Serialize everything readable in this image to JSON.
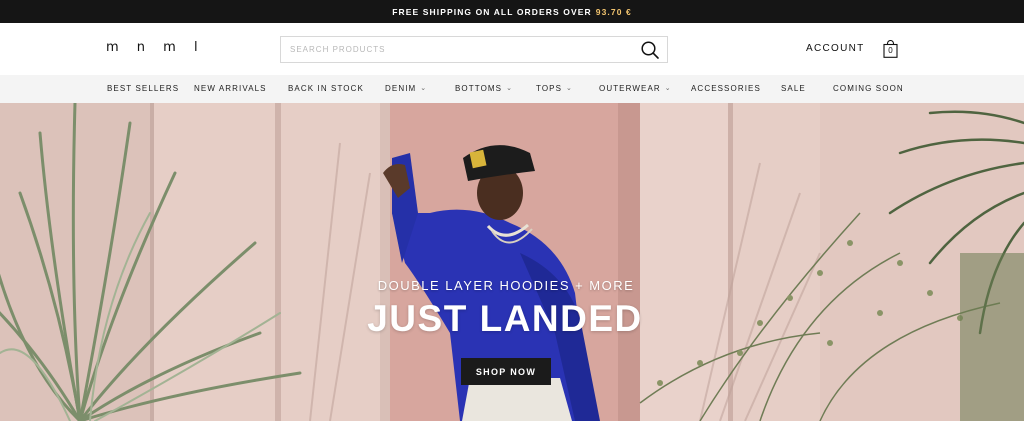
{
  "promo": {
    "text": "FREE SHIPPING ON ALL ORDERS OVER",
    "amount": "93.70 €"
  },
  "header": {
    "logo": "m n m l",
    "search_placeholder": "SEARCH PRODUCTS",
    "account_label": "ACCOUNT",
    "cart_count": "0"
  },
  "nav": {
    "items": [
      {
        "label": "BEST SELLERS",
        "dropdown": false
      },
      {
        "label": "NEW ARRIVALS",
        "dropdown": false
      },
      {
        "label": "BACK IN STOCK",
        "dropdown": false
      },
      {
        "label": "DENIM",
        "dropdown": true
      },
      {
        "label": "BOTTOMS",
        "dropdown": true
      },
      {
        "label": "TOPS",
        "dropdown": true
      },
      {
        "label": "OUTERWEAR",
        "dropdown": true
      },
      {
        "label": "ACCESSORIES",
        "dropdown": false
      },
      {
        "label": "SALE",
        "dropdown": false
      },
      {
        "label": "COMING SOON",
        "dropdown": false
      }
    ],
    "chevron": "⌄"
  },
  "hero": {
    "subtitle": "DOUBLE LAYER HOODIES + MORE",
    "title": "JUST LANDED",
    "cta_label": "SHOP NOW"
  },
  "colors": {
    "promo_bg": "#151515",
    "promo_amount": "#f2c46f",
    "nav_bg": "#f4f4f4",
    "hero_wall": "#e7cfc8",
    "hoodie": "#2b34b8",
    "cta_bg": "#1b1b1b"
  }
}
